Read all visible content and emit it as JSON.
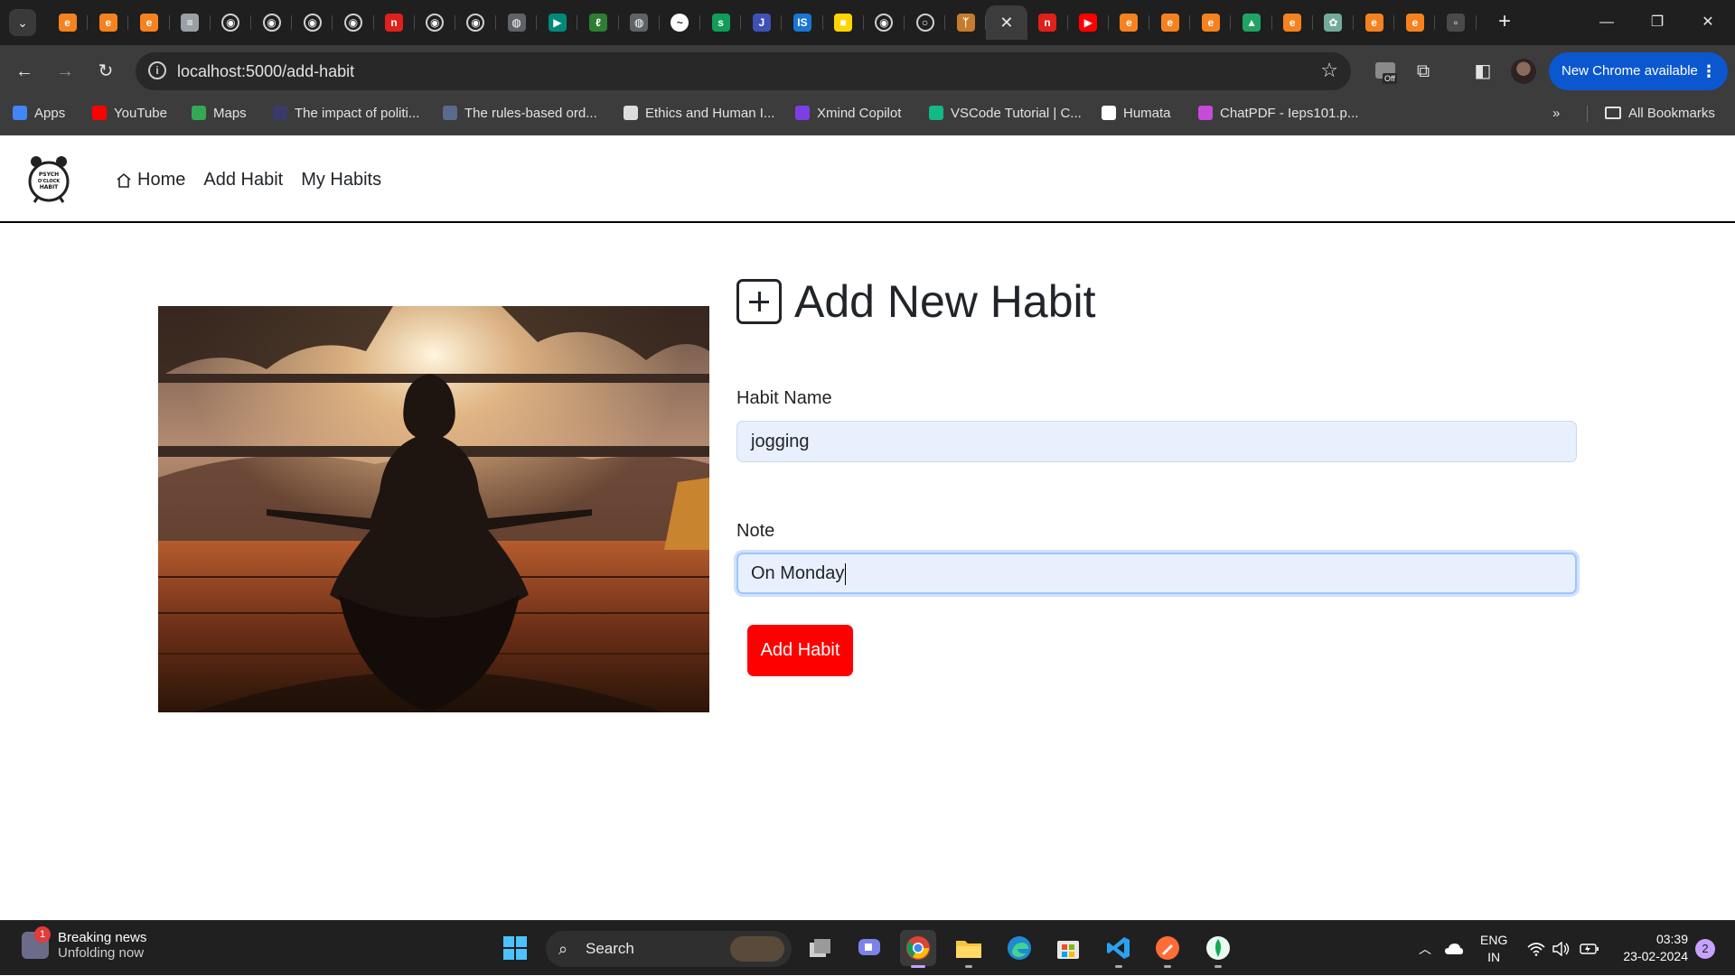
{
  "browser": {
    "tab_favicons": [
      {
        "icon": "edureka-icon",
        "color": "#f5821f",
        "glyph": "e"
      },
      {
        "icon": "edureka-icon",
        "color": "#f5821f",
        "glyph": "e"
      },
      {
        "icon": "edureka-icon",
        "color": "#f5821f",
        "glyph": "e"
      },
      {
        "icon": "doc-icon",
        "color": "#9aa0a6",
        "glyph": "≡"
      },
      {
        "icon": "github-icon",
        "color": "#1f1f1f",
        "glyph": "◉"
      },
      {
        "icon": "github-icon",
        "color": "#1f1f1f",
        "glyph": "◉"
      },
      {
        "icon": "github-icon",
        "color": "#1f1f1f",
        "glyph": "◉"
      },
      {
        "icon": "github-icon",
        "color": "#1f1f1f",
        "glyph": "◉"
      },
      {
        "icon": "red-n-icon",
        "color": "#e0201b",
        "glyph": "n"
      },
      {
        "icon": "github-icon",
        "color": "#1f1f1f",
        "glyph": "◉"
      },
      {
        "icon": "github-icon",
        "color": "#1f1f1f",
        "glyph": "◉"
      },
      {
        "icon": "globe-icon",
        "color": "#5f6368",
        "glyph": "◍"
      },
      {
        "icon": "meet-icon",
        "color": "#00897b",
        "glyph": "▶"
      },
      {
        "icon": "leaf-icon",
        "color": "#2e7d32",
        "glyph": "ℓ"
      },
      {
        "icon": "globe-icon",
        "color": "#5f6368",
        "glyph": "◍"
      },
      {
        "icon": "messenger-icon",
        "color": "#ffffff",
        "glyph": "~"
      },
      {
        "icon": "sheet-icon",
        "color": "#0f9d58",
        "glyph": "s"
      },
      {
        "icon": "jeu-icon",
        "color": "#3f51b5",
        "glyph": "J"
      },
      {
        "icon": "is-icon",
        "color": "#1976d2",
        "glyph": "IS"
      },
      {
        "icon": "flag-icon",
        "color": "#ffd500",
        "glyph": "■"
      },
      {
        "icon": "github-icon",
        "color": "#1f1f1f",
        "glyph": "◉"
      },
      {
        "icon": "loading-icon",
        "color": "#1f1f1f",
        "glyph": "○"
      },
      {
        "icon": "figure-icon",
        "color": "#c67c2c",
        "glyph": "ᛉ"
      },
      {
        "icon": "close-icon",
        "color": "#3c3c3c",
        "glyph": "✕"
      },
      {
        "icon": "red-n-icon",
        "color": "#e0201b",
        "glyph": "n"
      },
      {
        "icon": "youtube-icon",
        "color": "#ff0000",
        "glyph": "▶"
      },
      {
        "icon": "edureka-icon",
        "color": "#f5821f",
        "glyph": "e"
      },
      {
        "icon": "edureka-icon",
        "color": "#f5821f",
        "glyph": "e"
      },
      {
        "icon": "edureka-icon",
        "color": "#f5821f",
        "glyph": "e"
      },
      {
        "icon": "drive-icon",
        "color": "#1fa463",
        "glyph": "▲"
      },
      {
        "icon": "edureka-icon",
        "color": "#f5821f",
        "glyph": "e"
      },
      {
        "icon": "chatgpt-icon",
        "color": "#74aa9c",
        "glyph": "✿"
      },
      {
        "icon": "edureka-icon",
        "color": "#f5821f",
        "glyph": "e"
      },
      {
        "icon": "edureka-icon",
        "color": "#f5821f",
        "glyph": "e"
      },
      {
        "icon": "blank-icon",
        "color": "#4a4a4a",
        "glyph": "▫"
      }
    ],
    "active_tab_index": 23,
    "url": "localhost:5000/add-habit",
    "update_button": "New Chrome available",
    "extension_badge": "Off",
    "bookmarks": [
      {
        "label": "Apps",
        "icon": "apps-grid-icon",
        "color": "#4285f4"
      },
      {
        "label": "YouTube",
        "icon": "youtube-icon",
        "color": "#ff0000"
      },
      {
        "label": "Maps",
        "icon": "maps-pin-icon",
        "color": "#34a853"
      },
      {
        "label": "The impact of politi...",
        "icon": "bookmark-page-icon",
        "color": "#3a3a6a"
      },
      {
        "label": "The rules-based ord...",
        "icon": "bookmark-page-icon",
        "color": "#5a6a8a"
      },
      {
        "label": "Ethics and Human I...",
        "icon": "bookmark-page-icon",
        "color": "#dddddd"
      },
      {
        "label": "Xmind Copilot",
        "icon": "xmind-icon",
        "color": "#7b3fe4"
      },
      {
        "label": "VSCode Tutorial | C...",
        "icon": "vscode-tutorial-icon",
        "color": "#12b886"
      },
      {
        "label": "Humata",
        "icon": "humata-icon",
        "color": "#ffffff"
      },
      {
        "label": "ChatPDF - Ieps101.p...",
        "icon": "chatpdf-icon",
        "color": "#c64bd9"
      }
    ],
    "all_bookmarks": "All Bookmarks"
  },
  "site": {
    "logo_text": "PSYCH O'CLOCK HABIT",
    "nav": {
      "home": "Home",
      "add_habit": "Add Habit",
      "my_habits": "My Habits"
    }
  },
  "form": {
    "title": "Add New Habit",
    "habit_name_label": "Habit Name",
    "habit_name_value": "jogging",
    "note_label": "Note",
    "note_value": "On Monday",
    "submit_label": "Add Habit",
    "accent_color": "#ff0000"
  },
  "taskbar": {
    "news_title": "Breaking news",
    "news_subtitle": "Unfolding now",
    "news_badge": "1",
    "search_label": "Search",
    "lang_line1": "ENG",
    "lang_line2": "IN",
    "time": "03:39",
    "date": "23-02-2024",
    "notification_count": "2"
  }
}
